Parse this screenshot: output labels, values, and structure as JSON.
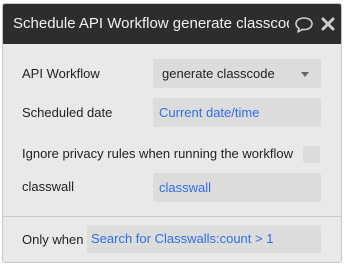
{
  "dialog": {
    "title": "Schedule API Workflow generate classcode"
  },
  "icons": {
    "comment": "speech-bubble-icon",
    "close": "close-icon"
  },
  "fields": {
    "api_workflow": {
      "label": "API Workflow",
      "value": "generate classcode"
    },
    "scheduled_date": {
      "label": "Scheduled date",
      "value": "Current date/time"
    },
    "ignore_privacy": {
      "label": "Ignore privacy rules when running the workflow",
      "checked": false
    },
    "classwall": {
      "label": "classwall",
      "value": "classwall"
    }
  },
  "condition": {
    "label": "Only when",
    "value": "Search for Classwalls:count > 1"
  },
  "colors": {
    "titlebar": "#2d2d2d",
    "panel": "#e9e9e9",
    "field": "#dcdcdc",
    "dynamic_text": "#2f6de8"
  }
}
